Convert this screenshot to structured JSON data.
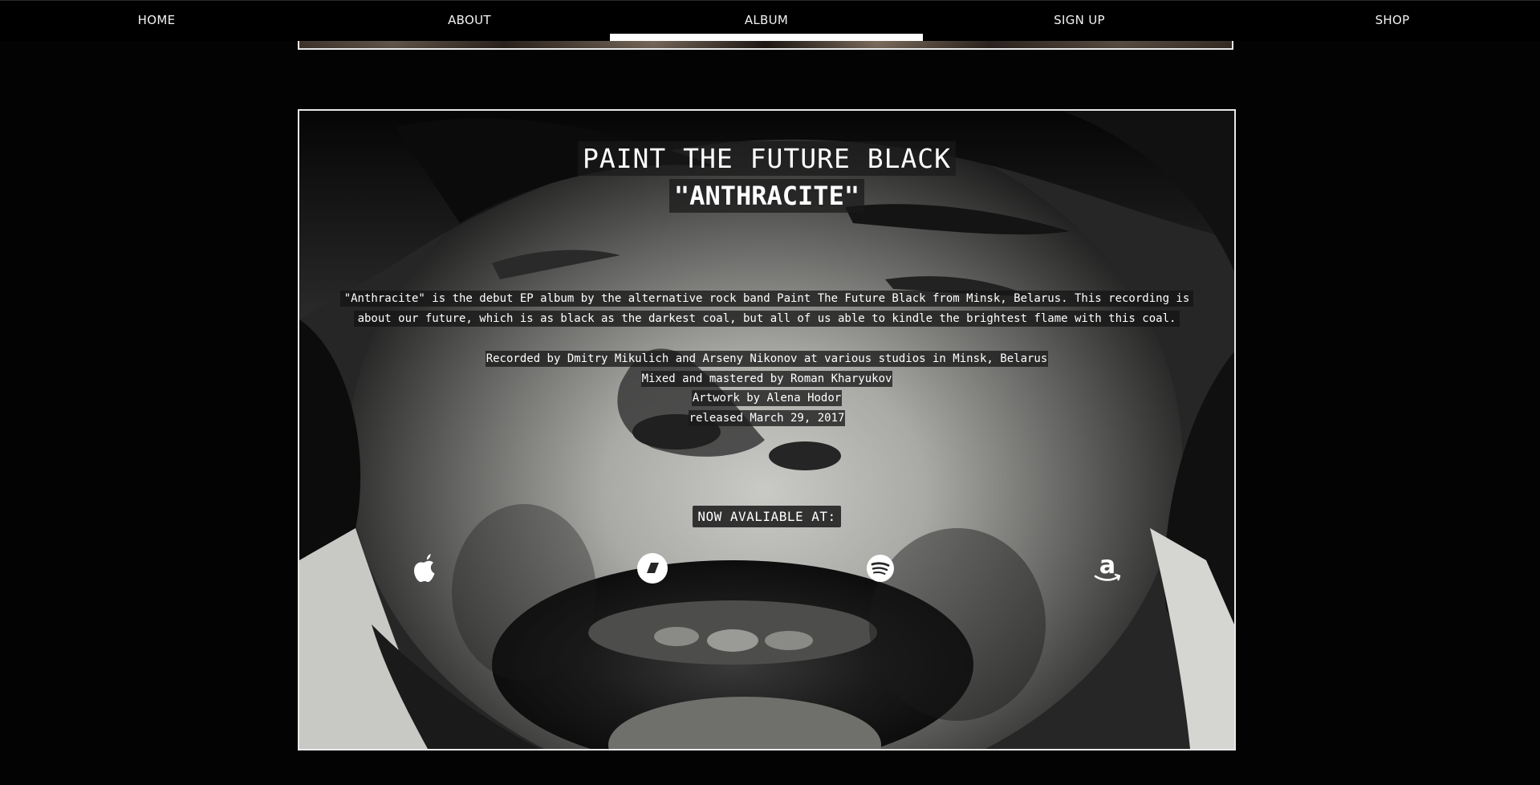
{
  "nav": {
    "items": [
      {
        "label": "HOME"
      },
      {
        "label": "ABOUT"
      },
      {
        "label": "ALBUM",
        "active": true
      },
      {
        "label": "SIGN UP"
      },
      {
        "label": "SHOP"
      }
    ]
  },
  "album": {
    "band": "PAINT THE FUTURE BLACK",
    "title": "\"ANTHRACITE\"",
    "description": "\"Anthracite\" is the debut EP album by the alternative rock band Paint The Future Black from Minsk, Belarus. This recording is about our future, which is as black as the darkest coal, but all of us able to kindle the brightest flame with this coal.",
    "credits": [
      "Recorded by Dmitry Mikulich and Arseny Nikonov at various studios in Minsk, Belarus",
      "Mixed and mastered by Roman Kharyukov",
      "Artwork by Alena Hodor",
      "released March 29, 2017"
    ],
    "availability_heading": "NOW AVALIABLE AT:",
    "stores": [
      {
        "icon": "apple-icon"
      },
      {
        "icon": "deezer-icon"
      },
      {
        "icon": "spotify-icon"
      },
      {
        "icon": "amazon-icon"
      }
    ]
  },
  "colors": {
    "background": "#030303",
    "text": "#ffffff",
    "nav_active_underline": "#ffffff",
    "frame_border": "#e9e9e9"
  }
}
